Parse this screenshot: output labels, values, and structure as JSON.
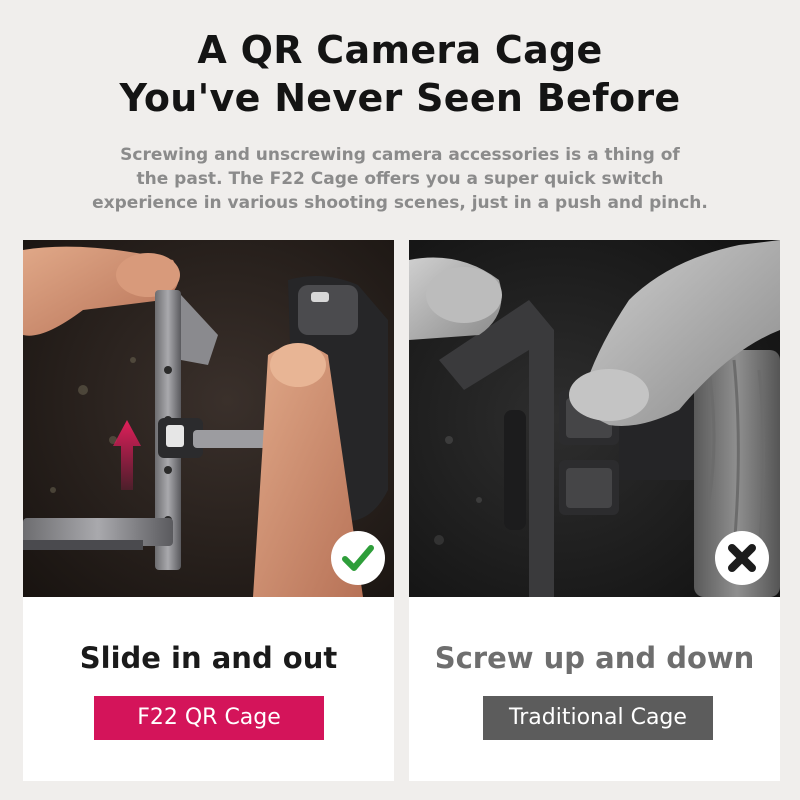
{
  "header": {
    "title_line1": "A QR Camera Cage",
    "title_line2": "You've Never Seen Before",
    "subtitle_line1": "Screwing and unscrewing camera accessories is a thing of",
    "subtitle_line2": "the past. The F22 Cage offers you a super quick switch",
    "subtitle_line3": "experience in various shooting scenes, just in a push and pinch."
  },
  "comparison": {
    "left": {
      "caption": "Slide in and out",
      "tag": "F22 QR Cage",
      "tag_color": "#d4145a",
      "badge_icon": "checkmark-icon",
      "badge_color": "#2e9e3a"
    },
    "right": {
      "caption": "Screw up and down",
      "tag": "Traditional Cage",
      "tag_color": "#5c5c5c",
      "badge_icon": "x-mark-icon",
      "badge_color": "#1c1c1c"
    }
  },
  "colors": {
    "background": "#f0eeec",
    "accent": "#d4145a"
  }
}
